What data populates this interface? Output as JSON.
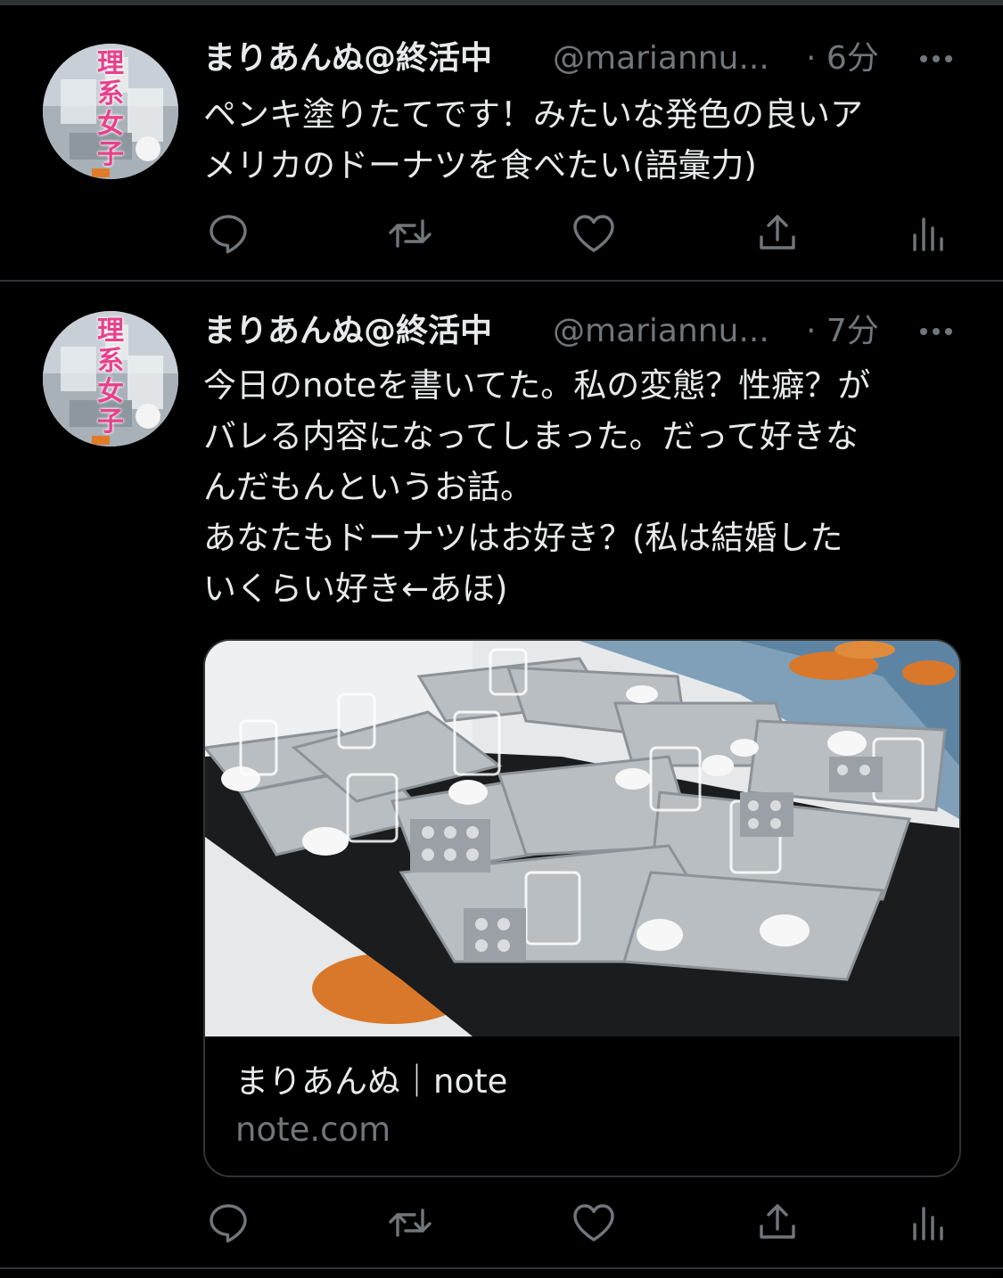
{
  "colors": {
    "background": "#000000",
    "text_primary": "#e7e9ea",
    "text_secondary": "#71767b",
    "border": "#2f3336"
  },
  "avatar": {
    "label_chars": [
      "理",
      "系",
      "女",
      "子"
    ]
  },
  "tweets": [
    {
      "author_name": "まりあんぬ@終活中",
      "handle": "@mariannu...",
      "time": "· 6分",
      "text": "ペンキ塗りたてです！みたいな発色の良いア\nメリカのドーナツを食べたい(語彙力)",
      "icons": [
        "reply-icon",
        "retweet-icon",
        "like-icon",
        "share-icon",
        "analytics-icon"
      ]
    },
    {
      "author_name": "まりあんぬ@終活中",
      "handle": "@mariannu...",
      "time": "· 7分",
      "text": "今日のnoteを書いてた。私の変態？性癖？が\nバレる内容になってしまった。だって好きな\nんだもんというお話。\nあなたもドーナツはお好き？(私は結婚した\nいくらい好き←あほ)",
      "card": {
        "title": "まりあんぬ｜note",
        "domain": "note.com",
        "image_description_icon": "lab-trays-photo"
      },
      "icons": [
        "reply-icon",
        "retweet-icon",
        "like-icon",
        "share-icon",
        "analytics-icon"
      ]
    }
  ]
}
